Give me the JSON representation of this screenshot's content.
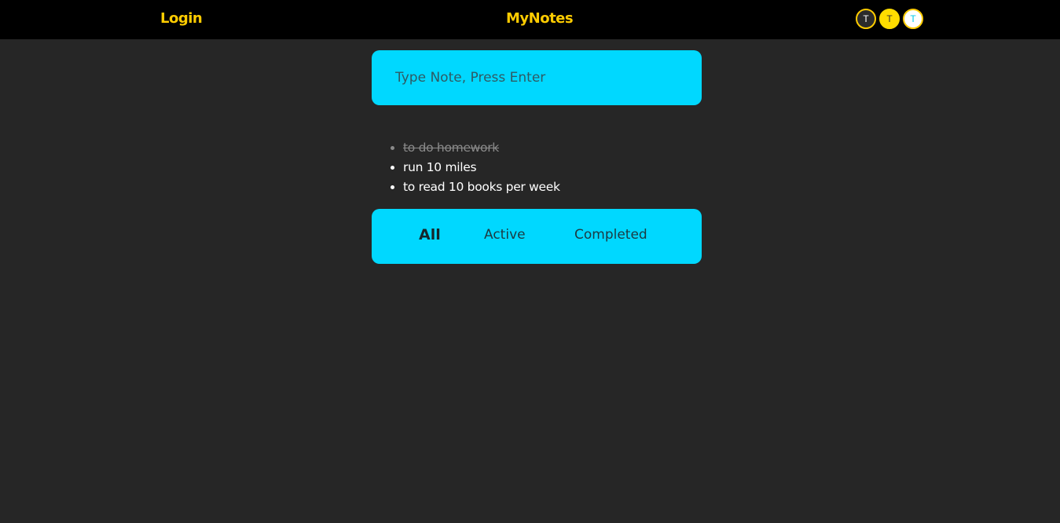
{
  "header": {
    "login_label": "Login",
    "brand_title": "MyNotes",
    "theme_buttons": [
      {
        "label": "T",
        "theme": "dark"
      },
      {
        "label": "T",
        "theme": "yellow"
      },
      {
        "label": "T",
        "theme": "light"
      }
    ]
  },
  "input": {
    "placeholder": "Type Note, Press Enter",
    "value": ""
  },
  "notes": [
    {
      "text": "to do homework",
      "completed": true
    },
    {
      "text": "run 10 miles",
      "completed": false
    },
    {
      "text": "to read 10 books per week",
      "completed": false
    }
  ],
  "filters": {
    "all_label": "All",
    "active_label": "Active",
    "completed_label": "Completed",
    "selected": "All"
  },
  "colors": {
    "accent_yellow": "#ffcc00",
    "panel_cyan": "#00d8ff",
    "background": "#262626",
    "header_bg": "#000000"
  }
}
